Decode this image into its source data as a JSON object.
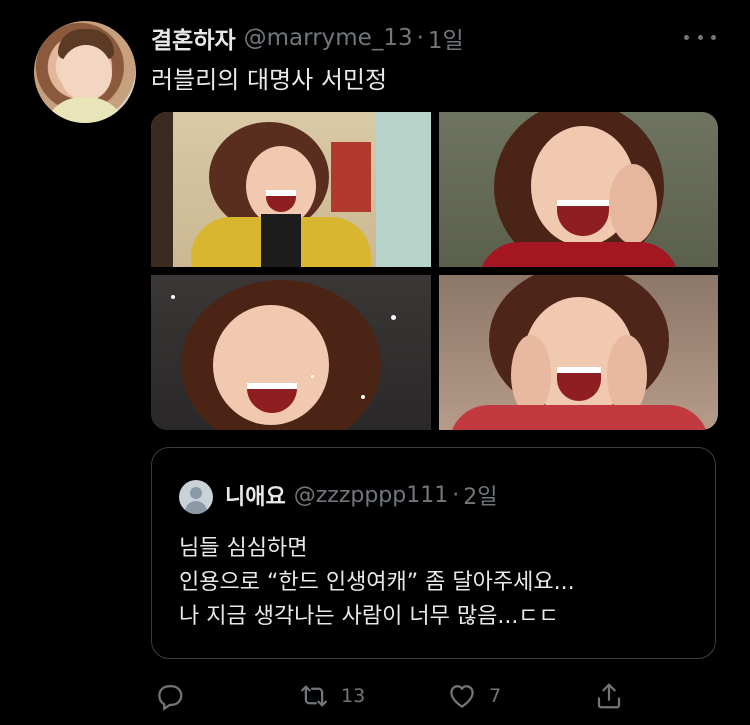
{
  "tweet": {
    "display_name": "결혼하자",
    "handle": "@marryme_13",
    "separator": "·",
    "time": "1일",
    "text": "러블리의 대명사 서민정",
    "more_icon": "more-horizontal-icon",
    "media_count": 4
  },
  "quote": {
    "display_name": "니애요",
    "handle": "@zzzpppp111",
    "separator": "·",
    "time": "2일",
    "lines": [
      "님들 심심하면",
      "인용으로 “한드 인생여캐” 좀 달아주세요...",
      "나 지금 생각나는 사람이 너무 많음...ㄷㄷ"
    ],
    "avatar_icon": "default-profile-icon"
  },
  "actions": {
    "reply": {
      "icon": "reply-icon",
      "count": ""
    },
    "retweet": {
      "icon": "retweet-icon",
      "count": "13"
    },
    "like": {
      "icon": "heart-icon",
      "count": "7"
    },
    "share": {
      "icon": "share-icon",
      "count": ""
    }
  },
  "colors": {
    "background": "#000000",
    "primary_text": "#e7e9ea",
    "secondary_text": "#71767b",
    "border": "#3a3d40"
  }
}
